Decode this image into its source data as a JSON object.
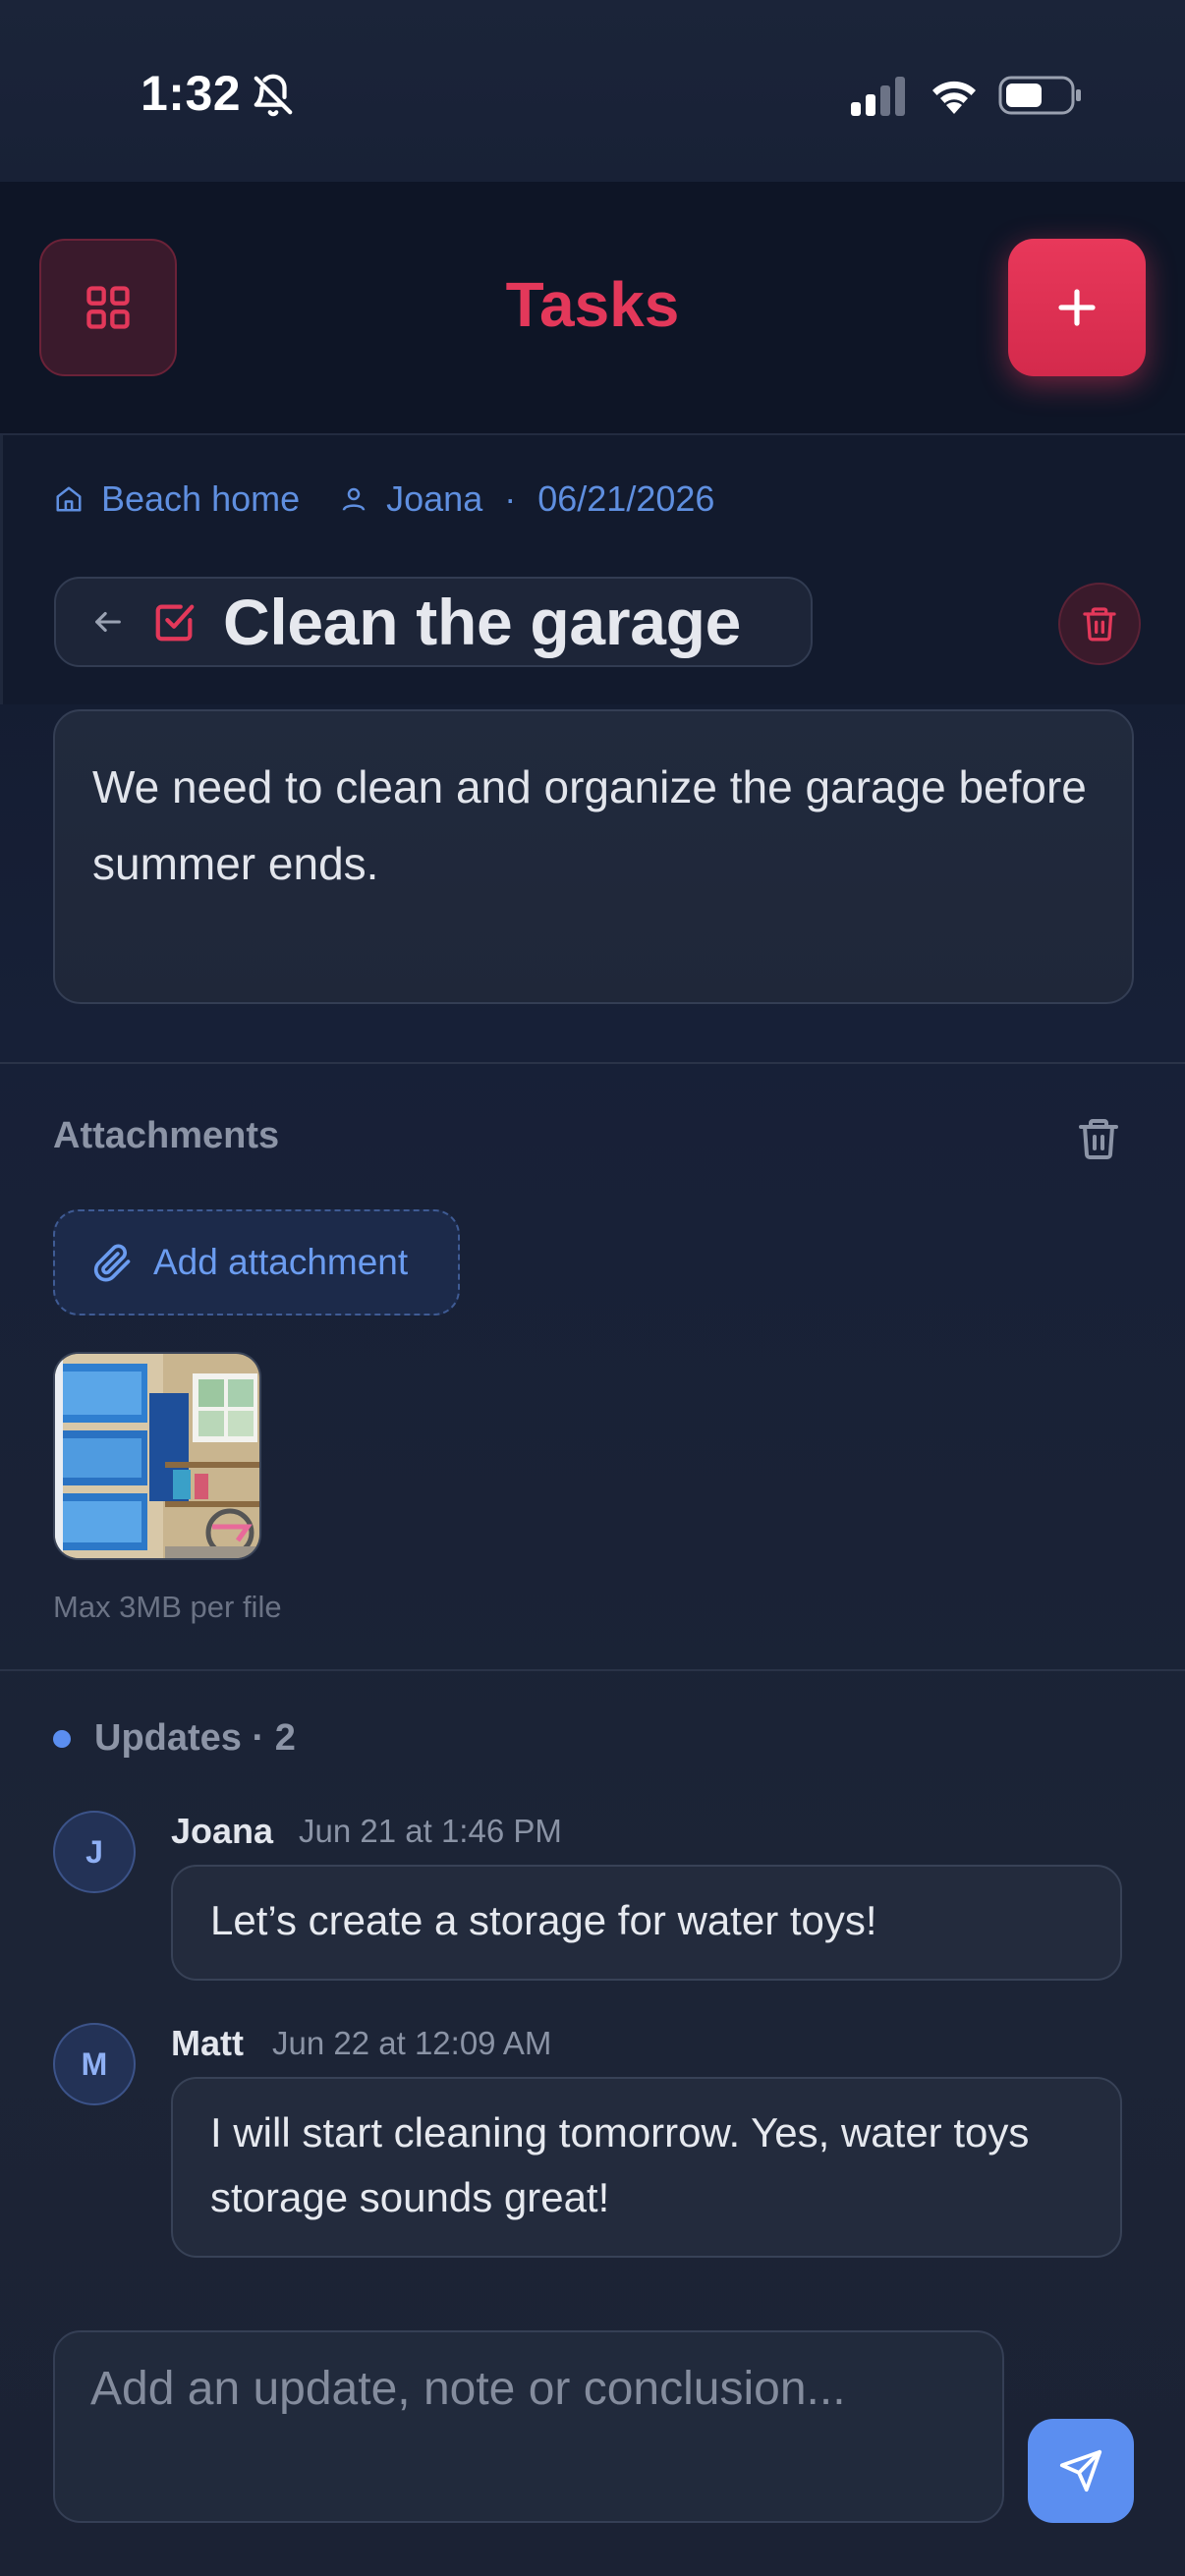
{
  "status_bar": {
    "time": "1:32"
  },
  "header": {
    "title": "Tasks"
  },
  "meta": {
    "location": "Beach home",
    "person": "Joana",
    "separator": "·",
    "date": "06/21/2026"
  },
  "task": {
    "title": "Clean the garage",
    "description": "We need to clean and organize the garage before summer ends."
  },
  "attachments": {
    "label": "Attachments",
    "add_label": "Add attachment",
    "note": "Max 3MB per file"
  },
  "updates": {
    "label": "Updates · 2",
    "items": [
      {
        "initial": "J",
        "author": "Joana",
        "time": "Jun 21 at 1:46 PM",
        "text": "Let’s create a storage for water toys!"
      },
      {
        "initial": "M",
        "author": "Matt",
        "time": "Jun 22 at 12:09 AM",
        "text": "I will start cleaning tomorrow. Yes, water toys storage sounds great!"
      }
    ]
  },
  "composer": {
    "placeholder": "Add an update, note or conclusion..."
  },
  "colors": {
    "accent": "#e3385a",
    "link": "#5f8fe0",
    "send": "#5b8ef0"
  }
}
